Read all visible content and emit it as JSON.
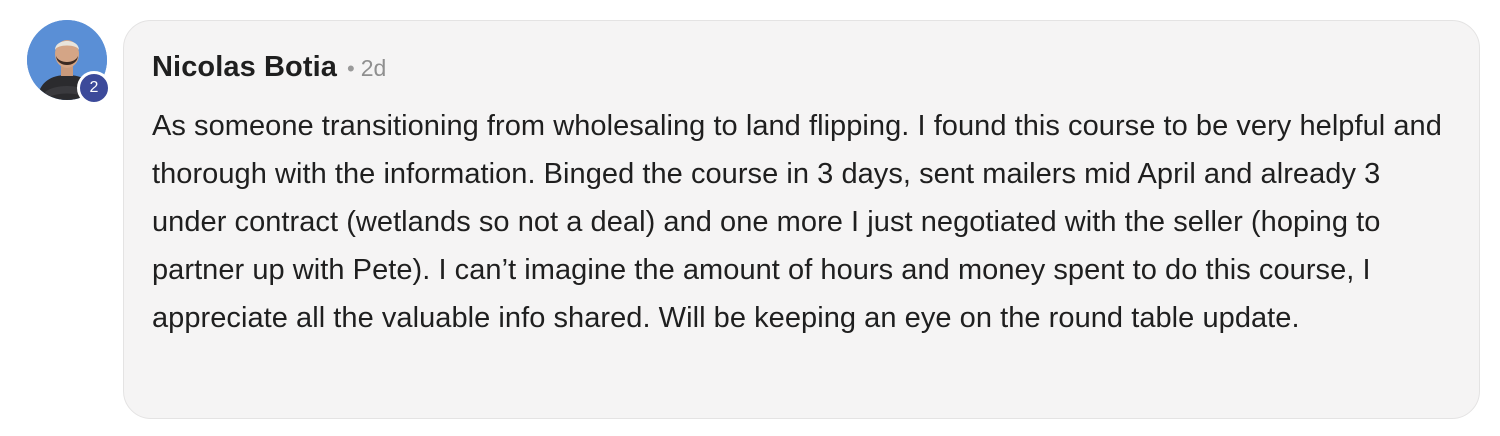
{
  "comment": {
    "author": "Nicolas Botia",
    "separator": "•",
    "timestamp": "2d",
    "level": "2",
    "body": "As someone transitioning from wholesaling to land flipping. I found this course to be very helpful and thorough with the information. Binged the course in 3 days, sent mailers mid April and already 3 under contract (wetlands so not a deal) and one more I just negotiated with the seller (hoping to partner up with Pete). I can’t imagine the amount of hours and money spent to do this course, I appreciate all the valuable info shared. Will be keeping an eye on the round table update."
  },
  "colors": {
    "bubble_background": "#f5f4f4",
    "badge_background": "#3c4a9a",
    "avatar_background": "#5a8fd6",
    "text": "#1f1f1f",
    "muted": "#8f8f8f"
  }
}
